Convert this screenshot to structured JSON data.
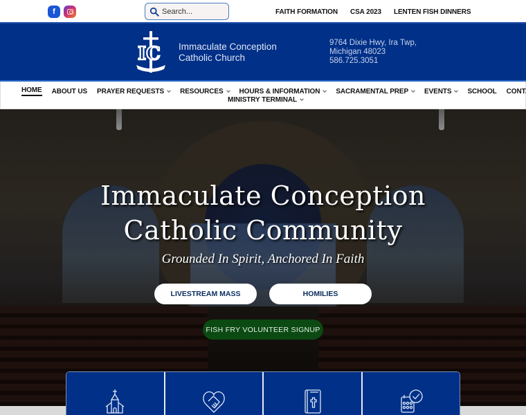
{
  "topbar": {
    "social": [
      {
        "name": "facebook",
        "glyph": "f"
      },
      {
        "name": "instagram",
        "glyph": ""
      }
    ],
    "search": {
      "placeholder": "Search..."
    },
    "links": [
      "FAITH FORMATION",
      "CSA 2023",
      "LENTEN FISH DINNERS"
    ]
  },
  "header": {
    "logo_text": "IC",
    "church_name_line1": "Immaculate Conception",
    "church_name_line2": "Catholic Church",
    "address_line1": "9764 Dixie Hwy, Ira Twp,",
    "address_line2": "Michigan 48023",
    "phone": "586.725.3051"
  },
  "nav": {
    "items": [
      {
        "label": "HOME",
        "dropdown": false,
        "active": true
      },
      {
        "label": "ABOUT US",
        "dropdown": false
      },
      {
        "label": "PRAYER REQUESTS",
        "dropdown": true
      },
      {
        "label": "RESOURCES",
        "dropdown": true
      },
      {
        "label": "HOURS & INFORMATION",
        "dropdown": true
      },
      {
        "label": "SACRAMENTAL PREP",
        "dropdown": true
      },
      {
        "label": "EVENTS",
        "dropdown": true
      },
      {
        "label": "SCHOOL",
        "dropdown": false
      },
      {
        "label": "CONTACT",
        "dropdown": false
      },
      {
        "label": "MINISTRY TERMINAL",
        "dropdown": true
      }
    ]
  },
  "hero": {
    "title_line1": "Immaculate Conception",
    "title_line2": "Catholic Community",
    "subtitle": "Grounded In Spirit, Anchored In Faith",
    "buttons": {
      "livestream": "LIVESTREAM MASS",
      "homilies": "HOMILIES",
      "fish_fry": "FISH FRY VOLUNTEER SIGNUP"
    }
  },
  "cards": [
    {
      "icon": "church-icon"
    },
    {
      "icon": "heart-handshake-icon"
    },
    {
      "icon": "bible-icon"
    },
    {
      "icon": "calendar-check-icon"
    }
  ],
  "colors": {
    "brand_blue": "#003087",
    "button_text_blue": "#0a2b5e",
    "fish_fry_green": "#0b4a12"
  }
}
